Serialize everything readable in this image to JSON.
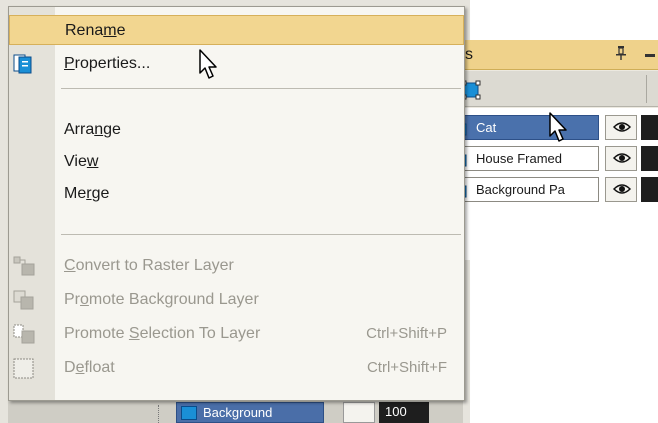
{
  "menu": {
    "items": [
      {
        "label_pre": "Rena",
        "label_u": "m",
        "label_post": "e",
        "shortcut": "",
        "enabled": true,
        "highlighted": true
      },
      {
        "label_pre": "",
        "label_u": "P",
        "label_post": "roperties...",
        "shortcut": "",
        "enabled": true,
        "highlighted": false
      },
      {
        "label_pre": "Arra",
        "label_u": "n",
        "label_post": "ge",
        "shortcut": "",
        "enabled": true,
        "highlighted": false
      },
      {
        "label_pre": "Vie",
        "label_u": "w",
        "label_post": "",
        "shortcut": "",
        "enabled": true,
        "highlighted": false
      },
      {
        "label_pre": "Me",
        "label_u": "r",
        "label_post": "ge",
        "shortcut": "",
        "enabled": true,
        "highlighted": false
      },
      {
        "label_pre": "",
        "label_u": "C",
        "label_post": "onvert to Raster Layer",
        "shortcut": "",
        "enabled": false,
        "highlighted": false
      },
      {
        "label_pre": "Pr",
        "label_u": "o",
        "label_post": "mote Background Layer",
        "shortcut": "",
        "enabled": false,
        "highlighted": false
      },
      {
        "label_pre": "Promote ",
        "label_u": "S",
        "label_post": "election To Layer",
        "shortcut": "Ctrl+Shift+P",
        "enabled": false,
        "highlighted": false
      },
      {
        "label_pre": "D",
        "label_u": "e",
        "label_post": "float",
        "shortcut": "Ctrl+Shift+F",
        "enabled": false,
        "highlighted": false
      }
    ]
  },
  "layers_palette": {
    "title": "Layers",
    "pin_glyph": "ᵖ",
    "layers": [
      {
        "name": "Cat",
        "selected": true
      },
      {
        "name": "House Framed",
        "selected": false
      },
      {
        "name": "Background Pa",
        "selected": false
      }
    ],
    "eye_glyph": "👁"
  },
  "underlay": {
    "background_layer_name": "Background",
    "background_opacity": "100"
  },
  "colors": {
    "highlight": "#f2d690",
    "selected_layer": "#4a71ac",
    "layer_icon": "#1a8fd6"
  }
}
